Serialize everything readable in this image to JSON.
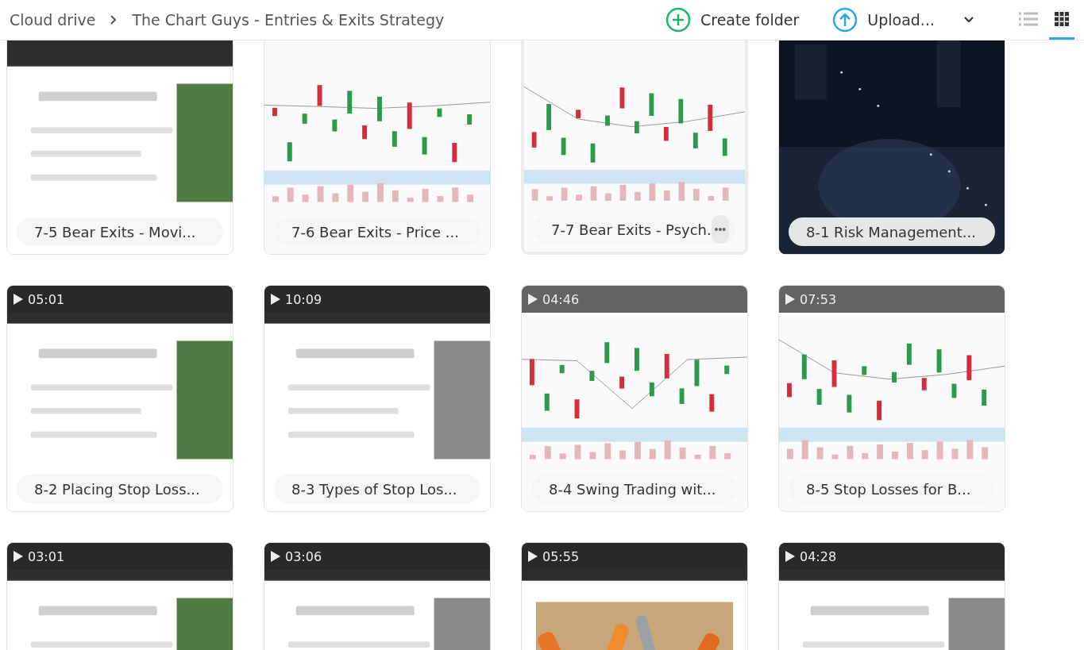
{
  "breadcrumb": [
    {
      "label": "Cloud drive"
    },
    {
      "label": "The Chart Guys - Entries & Exits Strategy"
    }
  ],
  "actions": [
    {
      "kind": "create",
      "label": "Create folder"
    },
    {
      "kind": "upload",
      "label": "Upload..."
    }
  ],
  "view_toggle": [
    {
      "kind": "list",
      "selected": false
    },
    {
      "kind": "grid",
      "selected": true
    }
  ],
  "files": [
    {
      "title": "7-5 Bear Exits - Movi...",
      "kind": "slide",
      "hovered": false
    },
    {
      "title": "7-6 Bear Exits - Price ...",
      "kind": "chart",
      "hovered": false
    },
    {
      "title": "7-7 Bear Exits - Psych.",
      "kind": "chart",
      "hovered": true,
      "more": "•••"
    },
    {
      "title": "8-1 Risk Management...",
      "kind": "dark",
      "hovered": false
    },
    {
      "title": "8-2 Placing Stop Loss...",
      "kind": "slide",
      "duration": "05:01",
      "hovered": false
    },
    {
      "title": "8-3 Types of Stop Los...",
      "kind": "slide",
      "duration": "10:09",
      "hovered": false
    },
    {
      "title": "8-4 Swing Trading wit...",
      "kind": "chart",
      "duration": "04:46",
      "hovered": false
    },
    {
      "title": "8-5 Stop Losses for B...",
      "kind": "chart",
      "duration": "07:53",
      "hovered": false
    },
    {
      "kind": "slide",
      "duration": "03:01",
      "hovered": false
    },
    {
      "kind": "slide",
      "duration": "03:06",
      "hovered": false
    },
    {
      "kind": "tools",
      "duration": "05:55",
      "hovered": false
    },
    {
      "kind": "slide",
      "duration": "04:28",
      "hovered": false
    }
  ]
}
